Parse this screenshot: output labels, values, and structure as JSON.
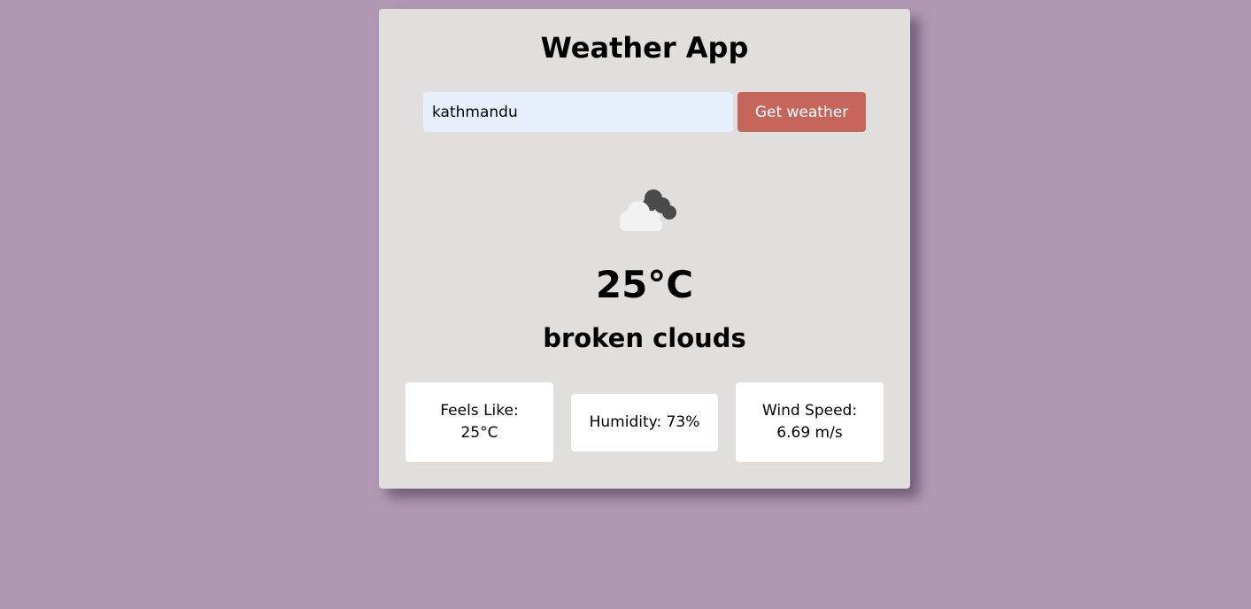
{
  "app": {
    "title": "Weather App"
  },
  "search": {
    "value": "kathmandu",
    "button_label": "Get weather"
  },
  "current": {
    "icon": "broken-clouds-icon",
    "temperature": "25°C",
    "description": "broken clouds"
  },
  "details": {
    "feels_like_label": "Feels Like:",
    "feels_like_value": "25°C",
    "humidity": "Humidity: 73%",
    "wind_label": "Wind Speed:",
    "wind_value": "6.69 m/s"
  },
  "colors": {
    "background": "#b199b3",
    "card": "#e0dfdd",
    "input": "#e7eefc",
    "button": "#c5655c"
  }
}
